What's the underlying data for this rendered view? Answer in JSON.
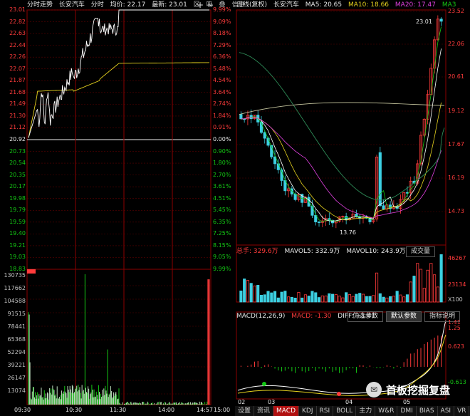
{
  "left": {
    "header": {
      "title": "分时走势",
      "stock": "长安汽车",
      "mode": "分时",
      "avg": "均价: 22.17",
      "latest": "最新: 23.01",
      "icons": [
        "区",
        "吸",
        "叠",
        "信息"
      ]
    },
    "price_left": [
      "23.01",
      "22.82",
      "22.63",
      "22.44",
      "22.26",
      "22.07",
      "21.87",
      "21.68",
      "21.49",
      "21.30",
      "21.12",
      "20.92",
      "20.73",
      "20.54",
      "20.35",
      "20.17",
      "19.98",
      "19.79",
      "19.59",
      "19.40",
      "19.21",
      "19.03",
      "18.83"
    ],
    "pct_right": [
      "9.99%",
      "9.09%",
      "8.18%",
      "7.29%",
      "6.36%",
      "5.48%",
      "4.54%",
      "3.64%",
      "2.74%",
      "1.84%",
      "0.91%",
      "0.00%",
      "0.90%",
      "1.80%",
      "2.70%",
      "3.61%",
      "4.51%",
      "5.45%",
      "6.35%",
      "7.25%",
      "8.15%",
      "9.05%",
      "9.99%"
    ],
    "vol_left": [
      "130735",
      "117662",
      "104588",
      "91515",
      "78441",
      "65368",
      "52294",
      "39221",
      "26147",
      "13074"
    ],
    "time_labels": [
      "09:30",
      "10:30",
      "11:30",
      "14:00",
      "14:57",
      "15:00"
    ]
  },
  "right": {
    "header": {
      "title": "日线(复权)",
      "stock": "长安汽车",
      "ma5": "MA5: 20.65",
      "ma10": "MA10: 18.66",
      "ma20": "MA20: 17.47",
      "ma3": "MA3",
      "icons": [
        "区",
        "吸",
        "叠",
        "信息"
      ]
    },
    "price_right": [
      "23.52",
      "22.06",
      "20.61",
      "19.12",
      "17.67",
      "16.19",
      "14.73"
    ],
    "high_label": "23.01",
    "low_label": "13.76",
    "vol_header": {
      "total": "总手: 329.6万",
      "mavol5": "MAVOL5: 332.9万",
      "mavol10": "MAVOL10: 243.9万",
      "button": "成交量"
    },
    "vol_right": [
      "46267",
      "23134",
      "X100"
    ],
    "macd_header": {
      "name": "MACD(12,26,9)",
      "macd": "MACD: -1.30",
      "diff": "DIFF: +1.41"
    },
    "macd_buttons": [
      "优选参数",
      "默认参数",
      "指标说明"
    ],
    "macd_right": [
      "1.41",
      "1.25",
      "0.623",
      "-0.613"
    ],
    "months": [
      "02",
      "03",
      "04",
      "05"
    ],
    "tabs": [
      "设置",
      "资讯",
      "MACD",
      "KDJ",
      "RSI",
      "BOLL",
      "主力",
      "W&R",
      "DMI",
      "BIAS",
      "ASI",
      "VR",
      "A"
    ]
  },
  "watermark": "首板挖掘复盘"
}
